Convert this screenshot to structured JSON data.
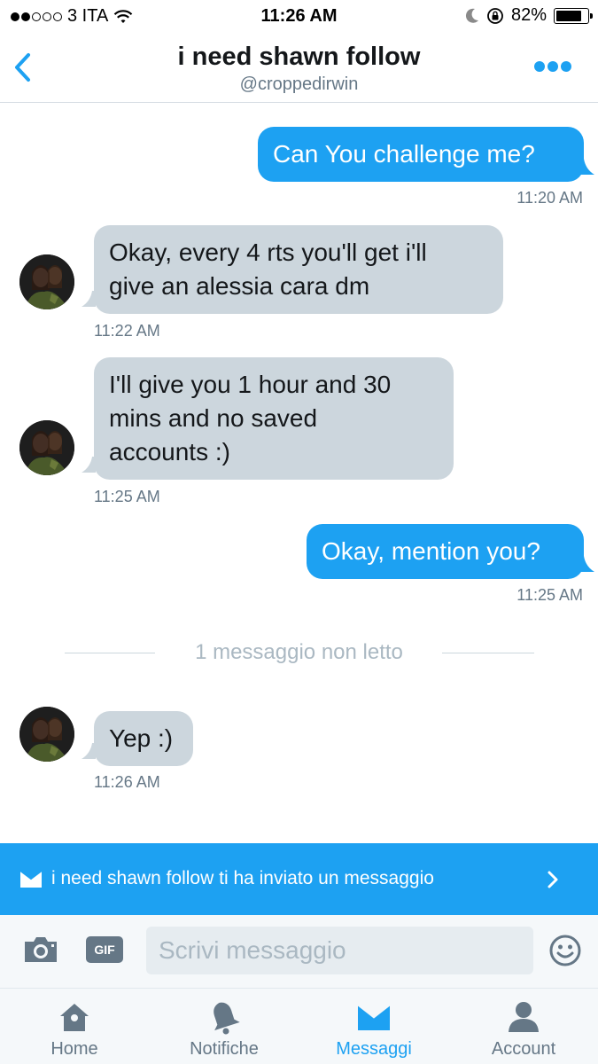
{
  "status_bar": {
    "carrier": "3 ITA",
    "time": "11:26 AM",
    "battery": "82%",
    "battery_level": 0.82,
    "signal_bars_filled": 2,
    "signal_bars_total": 5
  },
  "header": {
    "title": "i need shawn follow",
    "handle": "@croppedirwin"
  },
  "messages": [
    {
      "direction": "out",
      "text": "Can You challenge me?",
      "time": "11:20 AM"
    },
    {
      "direction": "in",
      "line1": "Okay, every 4 rts you'll get i'll",
      "line2": "give an alessia cara dm",
      "time": "11:22 AM"
    },
    {
      "direction": "in",
      "line1": "I'll give you 1 hour and 30",
      "line2": "mins and no saved",
      "line3": "accounts :)",
      "time": "11:25 AM"
    },
    {
      "direction": "out",
      "text": "Okay, mention you?",
      "time": "11:25 AM"
    },
    {
      "direction": "in",
      "text": "Yep :)",
      "time": "11:26 AM"
    }
  ],
  "unread_divider": "1 messaggio non letto",
  "banner": {
    "text": "i need shawn follow ti ha inviato un messaggio"
  },
  "composer": {
    "placeholder": "Scrivi messaggio",
    "value": "",
    "gif_label": "GIF"
  },
  "tabs": [
    {
      "label": "Home",
      "icon": "home-icon",
      "active": false
    },
    {
      "label": "Notifiche",
      "icon": "bell-icon",
      "active": false
    },
    {
      "label": "Messaggi",
      "icon": "envelope-icon",
      "active": true
    },
    {
      "label": "Account",
      "icon": "person-icon",
      "active": false
    }
  ],
  "colors": {
    "accent": "#1da1f2",
    "incoming_bubble": "#ccd6dd",
    "muted_text": "#657786"
  }
}
